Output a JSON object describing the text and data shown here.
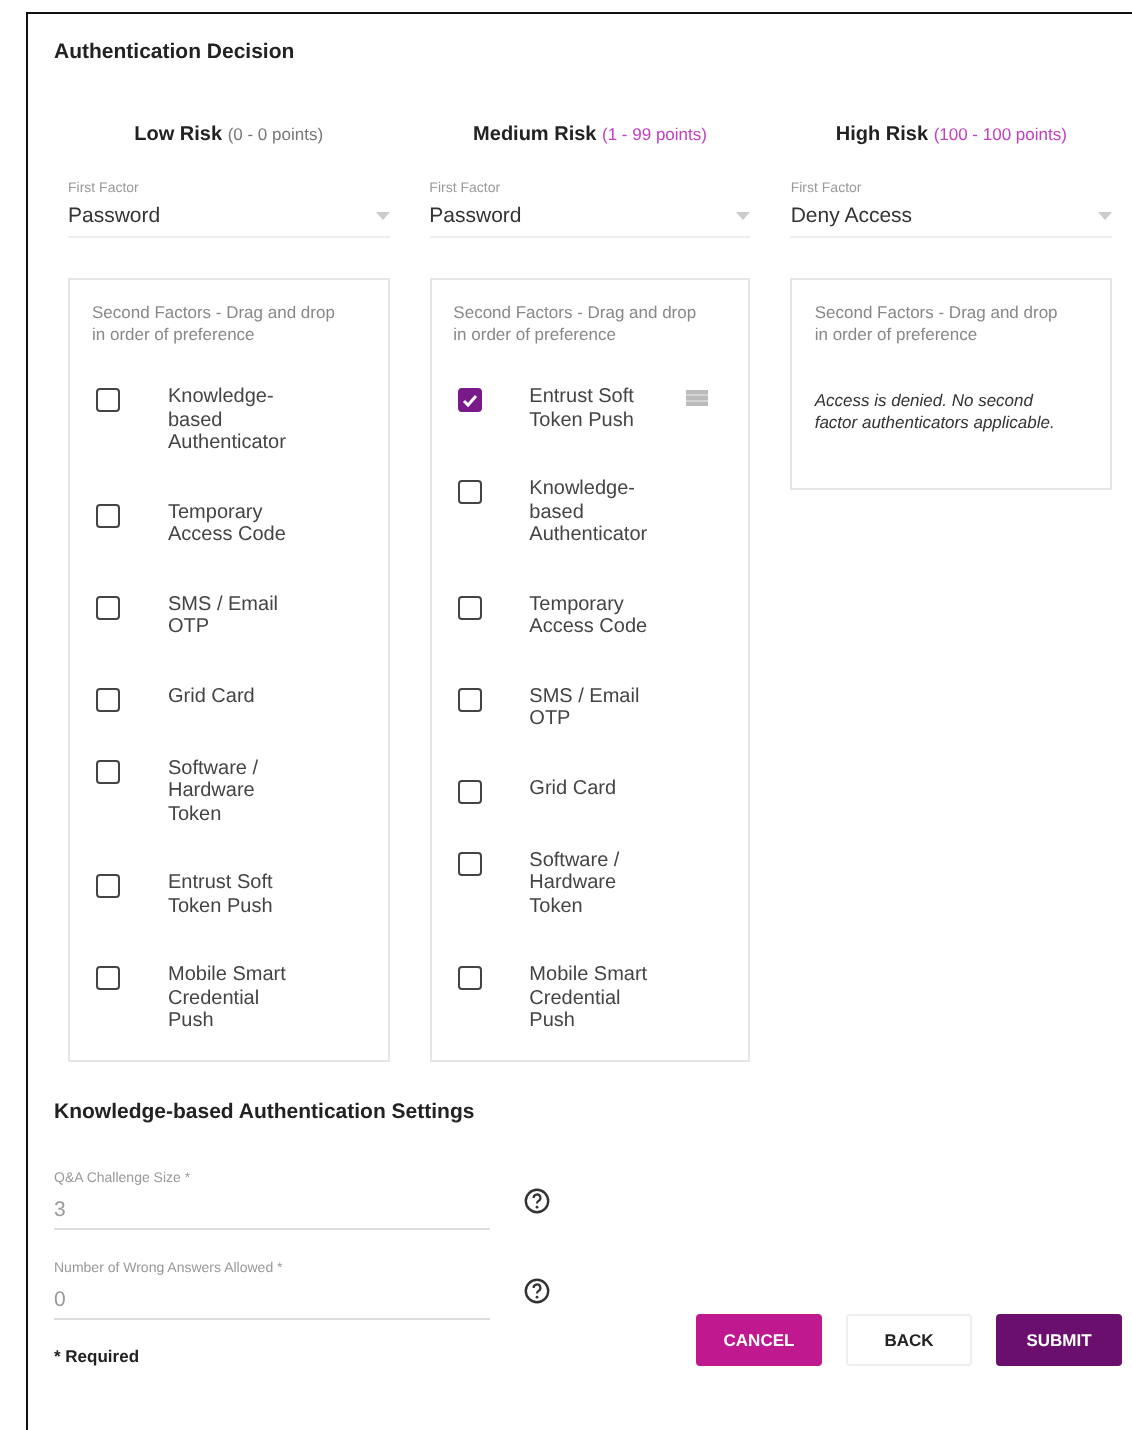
{
  "title": "Authentication Decision",
  "risk_levels": [
    {
      "name": "Low Risk",
      "range": "(0 - 0 points)",
      "highlighted": false,
      "first_factor": {
        "label": "First Factor",
        "value": "Password"
      },
      "second_factors": {
        "heading": "Second Factors - Drag and drop in order of preference",
        "items": [
          {
            "label": "Knowledge-based Authenticator",
            "checked": false
          },
          {
            "label": "Temporary Access Code",
            "checked": false
          },
          {
            "label": "SMS / Email OTP",
            "checked": false
          },
          {
            "label": "Grid Card",
            "checked": false
          },
          {
            "label": "Software / Hardware Token",
            "checked": false
          },
          {
            "label": "Entrust Soft Token Push",
            "checked": false
          },
          {
            "label": "Mobile Smart Credential Push",
            "checked": false
          }
        ]
      }
    },
    {
      "name": "Medium Risk",
      "range": "(1 - 99 points)",
      "highlighted": true,
      "first_factor": {
        "label": "First Factor",
        "value": "Password"
      },
      "second_factors": {
        "heading": "Second Factors - Drag and drop in order of preference",
        "items": [
          {
            "label": "Entrust Soft Token Push",
            "checked": true
          },
          {
            "label": "Knowledge-based Authenticator",
            "checked": false
          },
          {
            "label": "Temporary Access Code",
            "checked": false
          },
          {
            "label": "SMS / Email OTP",
            "checked": false
          },
          {
            "label": "Grid Card",
            "checked": false
          },
          {
            "label": "Software / Hardware Token",
            "checked": false
          },
          {
            "label": "Mobile Smart Credential Push",
            "checked": false
          }
        ]
      }
    },
    {
      "name": "High Risk",
      "range": "(100 - 100 points)",
      "highlighted": true,
      "first_factor": {
        "label": "First Factor",
        "value": "Deny Access"
      },
      "second_factors": {
        "heading": "Second Factors - Drag and drop in order of preference",
        "message": "Access is denied. No second factor authenticators applicable."
      }
    }
  ],
  "kba_settings": {
    "title": "Knowledge-based Authentication Settings",
    "fields": [
      {
        "label": "Q&A Challenge Size *",
        "value": "3"
      },
      {
        "label": "Number of Wrong Answers Allowed *",
        "value": "0"
      }
    ]
  },
  "required_note": "* Required",
  "buttons": [
    {
      "label": "CANCEL",
      "kind": "cancel"
    },
    {
      "label": "BACK",
      "kind": "back"
    },
    {
      "label": "SUBMIT",
      "kind": "submit"
    }
  ]
}
